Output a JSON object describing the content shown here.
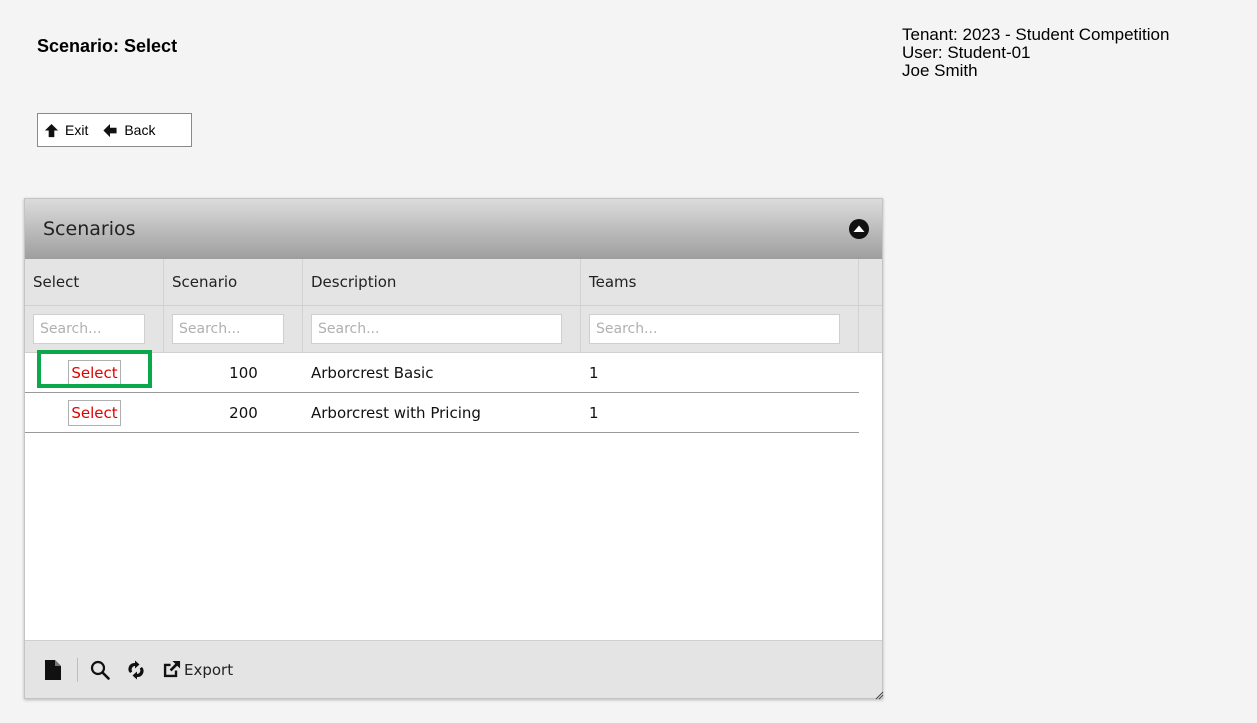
{
  "page": {
    "title": "Scenario: Select"
  },
  "user_info": {
    "tenant": "Tenant: 2023 - Student Competition",
    "user": "User: Student-01",
    "name": "Joe Smith"
  },
  "nav": {
    "exit_label": "Exit",
    "back_label": "Back"
  },
  "panel": {
    "title": "Scenarios",
    "columns": [
      "Select",
      "Scenario",
      "Description",
      "Teams"
    ],
    "search_placeholder": "Search...",
    "rows": [
      {
        "select_label": "Select",
        "scenario": "100",
        "description": "Arborcrest Basic",
        "teams": "1"
      },
      {
        "select_label": "Select",
        "scenario": "200",
        "description": "Arborcrest with Pricing",
        "teams": "1"
      }
    ],
    "highlight_color": "#0aa84a"
  },
  "toolbar": {
    "icons": [
      "new-document-icon",
      "search-icon",
      "refresh-icon",
      "export-icon"
    ],
    "export_label": "Export"
  },
  "colors": {
    "select_text": "#e00000",
    "header_gradient_top": "#dcdcdc",
    "header_gradient_bottom": "#9e9e9e"
  }
}
